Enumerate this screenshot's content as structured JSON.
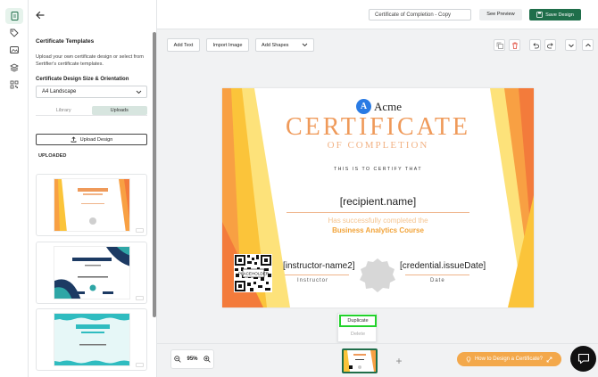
{
  "sidebar": {
    "title": "Certificate Templates",
    "description": "Upload your own certificate design or select from Sertifier's certificate templates.",
    "size_label": "Certificate Design Size & Orientation",
    "size_value": "A4 Landscape",
    "tabs": [
      {
        "label": "Library"
      },
      {
        "label": "Uploads"
      }
    ],
    "upload_button": "Upload Design",
    "uploaded_heading": "UPLOADED"
  },
  "header": {
    "design_name": "Certificate of Completion - Copy",
    "preview_label": "See Preview",
    "save_label": "Save Design"
  },
  "toolbar": {
    "add_text": "Add Text",
    "import_image": "Import Image",
    "add_shapes": "Add Shapes"
  },
  "certificate": {
    "logo_letter": "A",
    "logo_word": "Acme",
    "title": "CERTIFICATE",
    "subtitle": "OF COMPLETION",
    "certify": "THIS IS TO CERTIFY THAT",
    "recipient": "[recipient.name]",
    "has_completed": "Has successfully completed the",
    "course": "Business Analytics Course",
    "instructor": "[instructor-name2]",
    "instructor_label": "Instructor",
    "credential": "[credential.issueDate]",
    "date_label": "Date"
  },
  "context_menu": {
    "duplicate": "Duplicate",
    "delete": "Delete"
  },
  "footer": {
    "zoom": "95%",
    "help_label": "How to Design a Certificate?",
    "add_page": "+"
  },
  "colors": {
    "brand_green": "#1f6e4a",
    "accent_orange": "#ef9a5a",
    "highlight_green": "#22d22b"
  }
}
